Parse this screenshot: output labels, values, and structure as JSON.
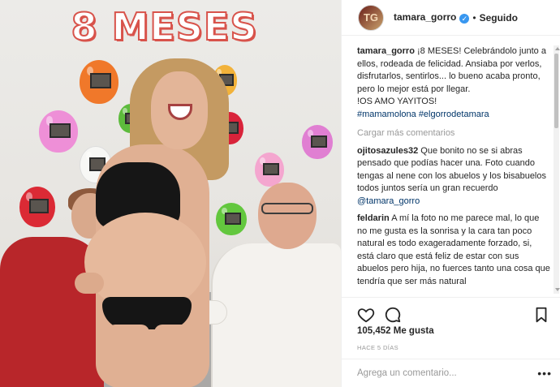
{
  "photo": {
    "title": "8 MESES"
  },
  "header": {
    "avatar_initials": "TG",
    "username": "tamara_gorro",
    "separator": "•",
    "follow_status": "Seguido"
  },
  "caption": {
    "username": "tamara_gorro",
    "text": "¡8 MESES! Celebrándolo junto a ellos, rodeada de felicidad. Ansiaba por verlos, disfrutarlos, sentirlos... lo bueno acaba pronto, pero lo mejor está por llegar.",
    "text2": "!OS AMO YAYITOS!",
    "hashtags": "#mamamolona #elgorrodetamara"
  },
  "load_more": "Cargar más comentarios",
  "comments": [
    {
      "username": "ojitosazules32",
      "text": "Que bonito no se si abras pensado que podías hacer una. Foto cuando tengas al nene con los abuelos y los bisabuelos todos juntos sería un gran recuerdo",
      "mention": "@tamara_gorro"
    },
    {
      "username": "feldarin",
      "text": "A mí la foto no me parece mal, lo que no me gusta es la sonrisa y la cara tan poco natural es todo exageradamente forzado, si, está claro que está feliz de estar con sus abuelos pero hija, no fuerces tanto una cosa que tendría que ser más natural"
    }
  ],
  "actions": {
    "like_icon": "heart-icon",
    "comment_icon": "comment-bubble-icon",
    "save_icon": "bookmark-icon"
  },
  "likes": "105,452 Me gusta",
  "time_ago": "HACE 5 DÍAS",
  "add_comment": {
    "placeholder": "Agrega un comentario...",
    "more": "•••"
  },
  "colors": {
    "title_red": "#d8534b",
    "verified_blue": "#3897f0",
    "link_blue": "#003569",
    "muted_gray": "#999999"
  }
}
